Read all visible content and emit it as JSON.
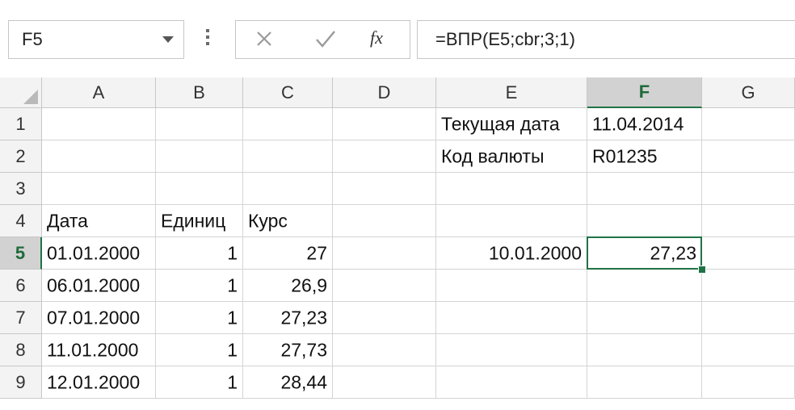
{
  "name_box": "F5",
  "formula": "=ВПР(E5;cbr;3;1)",
  "fx_label": "fx",
  "icons": {
    "cancel": "x-icon",
    "enter": "checkmark-icon",
    "insert_function": "fx-icon",
    "name_box_dropdown": "chevron-down-icon"
  },
  "columns": [
    "A",
    "B",
    "C",
    "D",
    "E",
    "F",
    "G"
  ],
  "rows": [
    "1",
    "2",
    "3",
    "4",
    "5",
    "6",
    "7",
    "8",
    "9"
  ],
  "selected_cell": "F5",
  "accent_color": "#217346",
  "cells": {
    "E1": "Текущая дата",
    "F1": "11.04.2014",
    "E2": "Код валюты",
    "F2": "R01235",
    "A4": "Дата",
    "B4": "Единиц",
    "C4": "Курс",
    "A5": "01.01.2000",
    "B5": "1",
    "C5": "27",
    "E5": "10.01.2000",
    "F5": "27,23",
    "A6": "06.01.2000",
    "B6": "1",
    "C6": "26,9",
    "A7": "07.01.2000",
    "B7": "1",
    "C7": "27,23",
    "A8": "11.01.2000",
    "B8": "1",
    "C8": "27,73",
    "A9": "12.01.2000",
    "B9": "1",
    "C9": "28,44"
  }
}
